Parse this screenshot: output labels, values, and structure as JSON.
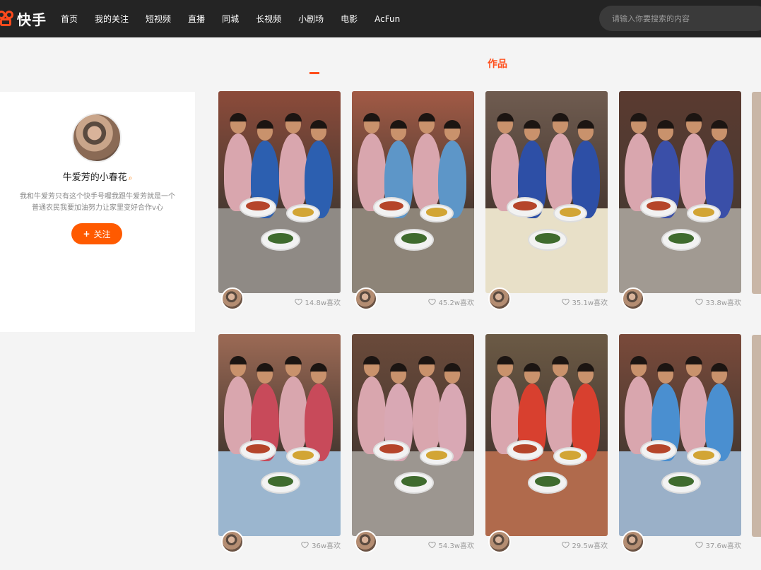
{
  "nav": {
    "logo_text": "快手",
    "items": [
      "首页",
      "我的关注",
      "短视频",
      "直播",
      "同城",
      "长视频",
      "小剧场",
      "电影",
      "AcFun"
    ],
    "search_placeholder": "请输入你要搜索的内容"
  },
  "profile": {
    "name": "牛爱芳的小春花",
    "bio": "我和牛爱芳只有这个快手号喔我跟牛爱芳就是一个普通农民我要加油努力让家里变好合作v心",
    "follow_label": "关注"
  },
  "section": {
    "title": "作品"
  },
  "videos": [
    {
      "likes": "14.8w喜欢",
      "wall": "#8c4b3a",
      "floor": "#8f8a85",
      "accent": "#2c5fb0"
    },
    {
      "likes": "45.2w喜欢",
      "wall": "#a25a45",
      "floor": "#8d8478",
      "accent": "#5d96c8"
    },
    {
      "likes": "35.1w喜欢",
      "wall": "#6f5c50",
      "floor": "#e8e0c8",
      "accent": "#2d4fa6"
    },
    {
      "likes": "33.8w喜欢",
      "wall": "#5a3a30",
      "floor": "#a19a92",
      "accent": "#3a4fa8"
    },
    {
      "likes": "36w喜欢",
      "wall": "#9c6a55",
      "floor": "#9bb6cf",
      "accent": "#c84a5a"
    },
    {
      "likes": "54.3w喜欢",
      "wall": "#6a4a3a",
      "floor": "#9c9690",
      "accent": "#d9a8b4"
    },
    {
      "likes": "29.5w喜欢",
      "wall": "#6b5a45",
      "floor": "#b06a4c",
      "accent": "#d8402f"
    },
    {
      "likes": "37.6w喜欢",
      "wall": "#7a4a3a",
      "floor": "#9ab0c8",
      "accent": "#4a8fd0"
    }
  ]
}
